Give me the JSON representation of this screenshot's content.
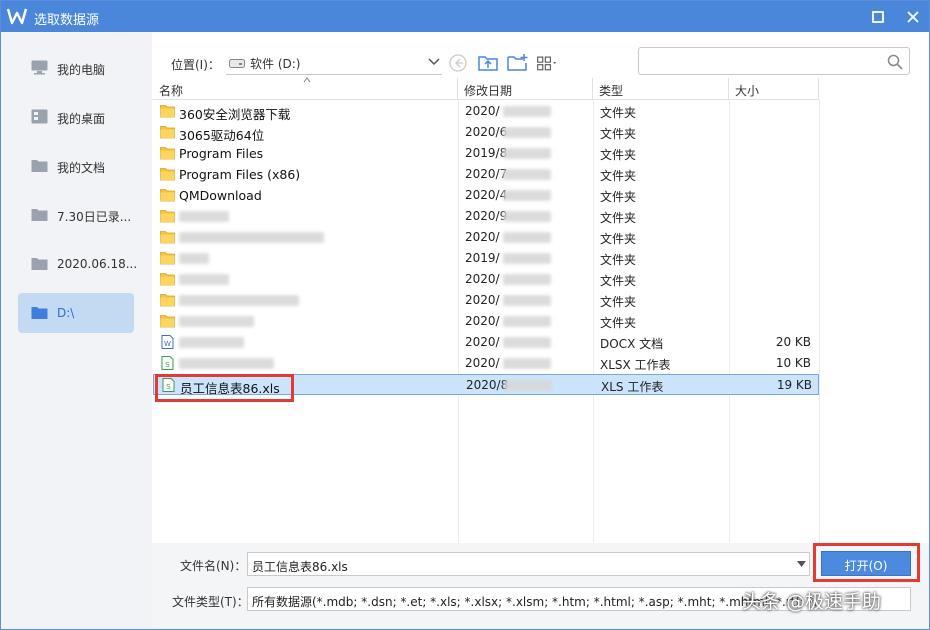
{
  "window": {
    "title": "选取数据源"
  },
  "sidebar": {
    "items": [
      {
        "label": "我的电脑",
        "icon": "computer-icon"
      },
      {
        "label": "我的桌面",
        "icon": "desktop-icon"
      },
      {
        "label": "我的文档",
        "icon": "folder-icon"
      },
      {
        "label": "7.30日已录...",
        "icon": "folder-icon"
      },
      {
        "label": "2020.06.18...",
        "icon": "folder-icon"
      },
      {
        "label": "D:\\",
        "icon": "folder-icon",
        "active": true
      }
    ]
  },
  "toolbar": {
    "location_label": "位置(I)：",
    "location_value": "软件 (D:)",
    "search_placeholder": ""
  },
  "columns": {
    "name": "名称",
    "date": "修改日期",
    "type": "类型",
    "size": "大小"
  },
  "files": [
    {
      "name": "360安全浏览器下载",
      "date": "2020/",
      "type": "文件夹",
      "size": "",
      "icon": "folder-icon"
    },
    {
      "name": "3065驱动64位",
      "date": "2020/6",
      "type": "文件夹",
      "size": "",
      "icon": "folder-icon"
    },
    {
      "name": "Program Files",
      "date": "2019/8",
      "type": "文件夹",
      "size": "",
      "icon": "folder-icon"
    },
    {
      "name": "Program Files (x86)",
      "date": "2020/7",
      "type": "文件夹",
      "size": "",
      "icon": "folder-icon"
    },
    {
      "name": "QMDownload",
      "date": "2020/4",
      "type": "文件夹",
      "size": "",
      "icon": "folder-icon"
    },
    {
      "name": "",
      "date": "2020/9",
      "type": "文件夹",
      "size": "",
      "icon": "folder-icon"
    },
    {
      "name": "",
      "date": "2020/",
      "type": "文件夹",
      "size": "",
      "icon": "folder-icon"
    },
    {
      "name": "",
      "date": "2019/",
      "type": "文件夹",
      "size": "",
      "icon": "folder-icon"
    },
    {
      "name": "",
      "date": "2020/",
      "type": "文件夹",
      "size": "",
      "icon": "folder-icon"
    },
    {
      "name": "",
      "date": "2020/",
      "type": "文件夹",
      "size": "",
      "icon": "folder-icon"
    },
    {
      "name": "",
      "date": "2020/",
      "type": "文件夹",
      "size": "",
      "icon": "folder-icon"
    },
    {
      "name": "",
      "date": "2020/",
      "type": "DOCX 文档",
      "size": "20 KB",
      "icon": "docx-icon"
    },
    {
      "name": "",
      "date": "2020/",
      "type": "XLSX 工作表",
      "size": "10 KB",
      "icon": "xlsx-icon"
    },
    {
      "name": "员工信息表86.xls",
      "date": "2020/8",
      "type": "XLS 工作表",
      "size": "19 KB",
      "icon": "xls-icon",
      "selected": true
    }
  ],
  "footer": {
    "filename_label": "文件名(N)：",
    "filename_value": "员工信息表86.xls",
    "filetype_label": "文件类型(T)：",
    "filetype_value": "所有数据源(*.mdb; *.dsn; *.et; *.xls; *.xlsx; *.xlsm; *.htm; *.html; *.asp; *.mht; *.mhtml; *.rtf; *.",
    "open_label": "打开(O)"
  },
  "watermark": "头条 @极速手助",
  "colors": {
    "titlebar": "#4a86d9",
    "accent": "#4c8ae0",
    "highlight": "#e23b36",
    "selected_row": "#cce4fb"
  }
}
